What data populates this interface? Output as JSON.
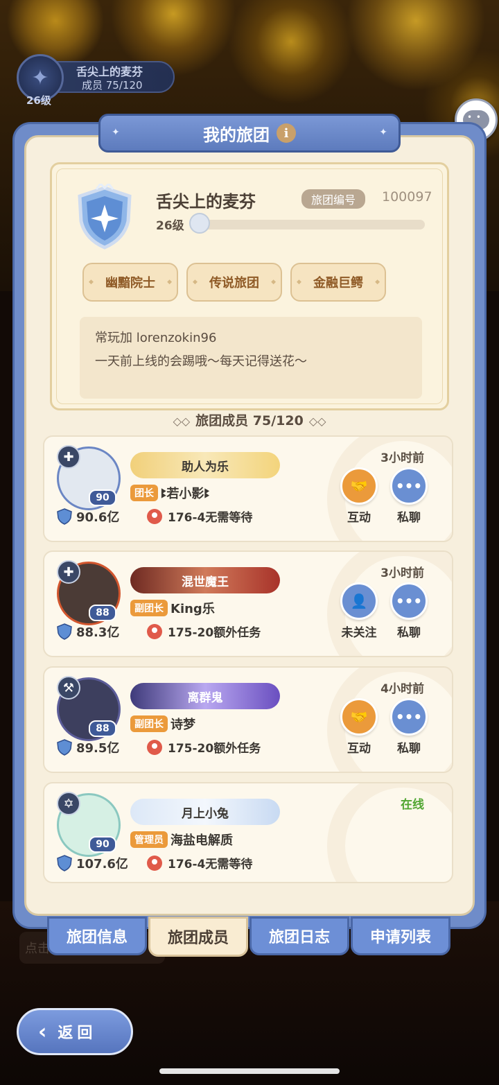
{
  "guild_badge": {
    "name": "舌尖上的麦芬",
    "members": "成员  75/120",
    "level": "26级"
  },
  "panel": {
    "title": "我的旅团"
  },
  "guild": {
    "name": "舌尖上的麦芬",
    "id_label": "旅团编号",
    "id_value": "100097",
    "level": "26级",
    "tags": [
      "幽黯院士",
      "传说旅团",
      "金融巨鳄"
    ],
    "notice_line1": "常玩加 lorenzokin96",
    "notice_line2": "一天前上线的会踢哦～每天记得送花～"
  },
  "members_header": "旅团成员 75/120",
  "members": [
    {
      "nameplate": "助人为乐",
      "role": "团长",
      "name": "ꔪ若小影ꔪ",
      "level": "90",
      "power": "90.6亿",
      "mission": "176-4无需等待",
      "time": "3小时前",
      "action1": "互动",
      "action2": "私聊",
      "color_plate": "#f6dd8c"
    },
    {
      "nameplate": "混世魔王",
      "role": "副团长",
      "name": "King乐",
      "level": "88",
      "power": "88.3亿",
      "mission": "175-20额外任务",
      "time": "3小时前",
      "action1": "未关注",
      "action2": "私聊",
      "color_plate": "#d88070"
    },
    {
      "nameplate": "离群鬼",
      "role": "副团长",
      "name": "诗梦",
      "level": "88",
      "power": "89.5亿",
      "mission": "175-20额外任务",
      "time": "4小时前",
      "action1": "互动",
      "action2": "私聊",
      "color_plate": "#9a86d8"
    },
    {
      "nameplate": "月上小兔",
      "role": "管理员",
      "name": "海盐电解质",
      "level": "90",
      "power": "107.6亿",
      "mission": "176-4无需等待",
      "time": "在线",
      "color_plate": "#cfe0f5"
    }
  ],
  "tabs": [
    "旅团信息",
    "旅团成员",
    "旅团日志",
    "申请列表"
  ],
  "faded_input": "点击",
  "back_label": "返回"
}
